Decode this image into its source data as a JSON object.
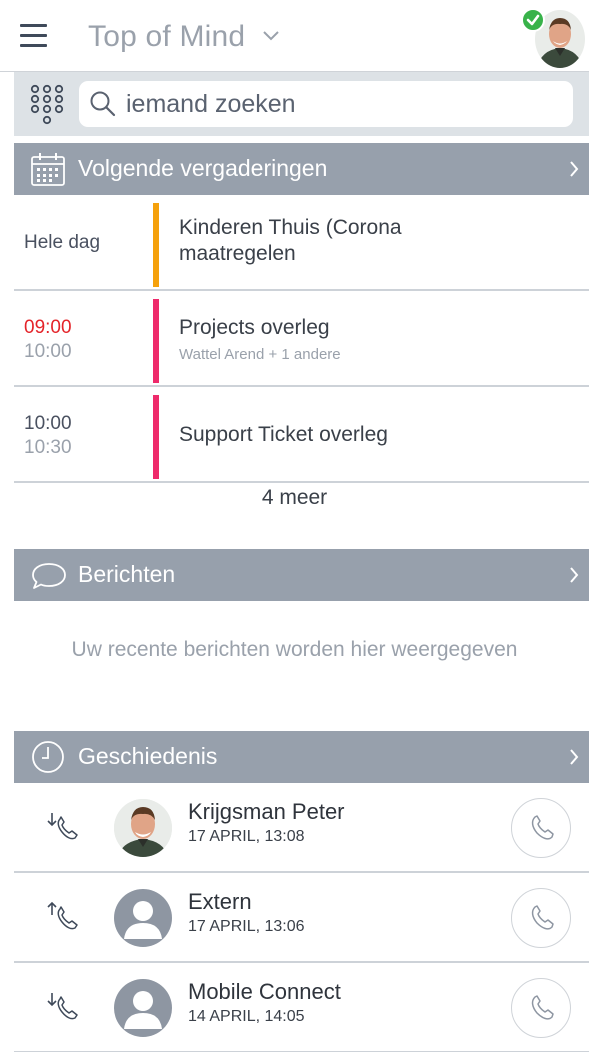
{
  "header": {
    "title": "Top of Mind",
    "menu_icon": "hamburger-icon",
    "dropdown_icon": "chevron-down-icon",
    "status_color": "#38b24a"
  },
  "search": {
    "placeholder": "iemand zoeken",
    "dialpad_icon": "dialpad-icon",
    "search_icon": "search-icon"
  },
  "meetings": {
    "header": "Volgende vergaderingen",
    "icon": "calendar-icon",
    "items": [
      {
        "time_start": "Hele dag",
        "time_end": "",
        "title": "Kinderen Thuis (Corona maatregelen",
        "subtitle": "",
        "color": "#f5a10c"
      },
      {
        "time_start": "09:00",
        "time_end": "10:00",
        "title": "Projects overleg",
        "subtitle": "Wattel Arend + 1 andere",
        "color": "#ee2a6b",
        "start_color": "#e4242a"
      },
      {
        "time_start": "10:00",
        "time_end": "10:30",
        "title": "Support Ticket overleg",
        "subtitle": "",
        "color": "#ee2a6b"
      }
    ],
    "more": "4 meer"
  },
  "messages": {
    "header": "Berichten",
    "icon": "speech-bubble-icon",
    "empty": "Uw recente berichten worden hier weergegeven"
  },
  "history": {
    "header": "Geschiedenis",
    "icon": "clock-icon",
    "items": [
      {
        "name": "Krijgsman Peter",
        "date": "17 APRIL, 13:08",
        "direction": "incoming-call-icon",
        "avatar": "photo"
      },
      {
        "name": "Extern",
        "date": "17 APRIL, 13:06",
        "direction": "outgoing-call-icon",
        "avatar": "placeholder"
      },
      {
        "name": "Mobile Connect",
        "date": "14 APRIL, 14:05",
        "direction": "incoming-call-icon",
        "avatar": "placeholder"
      }
    ]
  }
}
